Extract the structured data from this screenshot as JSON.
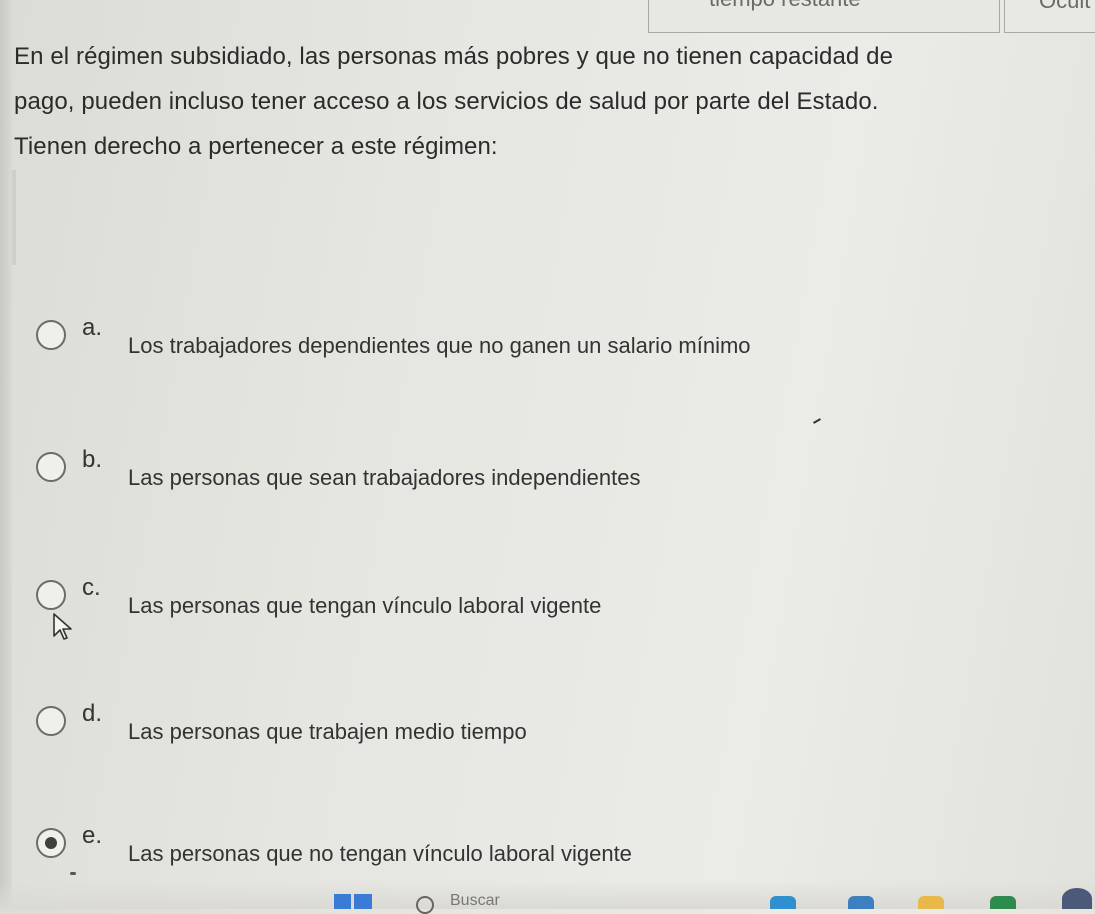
{
  "header": {
    "box_text": "tiempo restante",
    "button_text": "Ocult"
  },
  "question": {
    "lines": [
      "En el régimen subsidiado, las personas más pobres y que no tienen capacidad de",
      "pago, pueden incluso tener acceso a los servicios de salud por parte del Estado.",
      "Tienen derecho a pertenecer a este régimen:"
    ]
  },
  "options": [
    {
      "letter": "a.",
      "text": "Los trabajadores dependientes que no ganen un salario mínimo",
      "selected": false
    },
    {
      "letter": "b.",
      "text": "Las personas que sean trabajadores independientes",
      "selected": false
    },
    {
      "letter": "c.",
      "text": "Las personas que tengan vínculo laboral vigente",
      "selected": false
    },
    {
      "letter": "d.",
      "text": "Las personas que trabajen medio tiempo",
      "selected": false
    },
    {
      "letter": "e.",
      "text": "Las personas que no tengan vínculo laboral vigente",
      "selected": true
    }
  ],
  "taskbar": {
    "search_label": "Buscar",
    "icons": [
      "start-icon",
      "search-icon",
      "edge-icon",
      "store-icon",
      "explorer-icon",
      "excel-icon",
      "chrome-icon"
    ]
  },
  "colors": {
    "background": "#e6e6e1",
    "text": "#2b2b2b",
    "radio_border": "#6b6b68",
    "start_blue": "#3a7bd5"
  }
}
